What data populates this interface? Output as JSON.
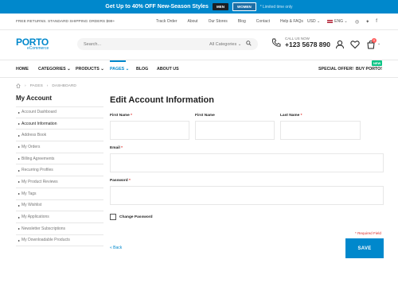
{
  "promo": {
    "text": "Get Up to 40% OFF New-Season Styles",
    "men": "MEN",
    "women": "WOMEN",
    "note": "* Limited time only"
  },
  "topbar": {
    "free_returns": "FREE RETURNS. STANDARD SHIPPING ORDERS $99+",
    "links": [
      "Track Order",
      "About",
      "Our Stores",
      "Blog",
      "Contact",
      "Help & FAQs"
    ],
    "currency": "USD",
    "language": "ENG"
  },
  "header": {
    "logo": "PORTO",
    "logo_sub": "eCommerce",
    "search_placeholder": "Search...",
    "search_category": "All Categories",
    "call_label": "CALL US NOW",
    "call_number": "+123 5678 890",
    "cart_count": "0"
  },
  "nav": {
    "items": [
      "HOME",
      "CATEGORIES",
      "PRODUCTS",
      "PAGES",
      "BLOG",
      "ABOUT US"
    ],
    "special_offer": "SPECIAL OFFER!",
    "buy": "BUY PORTO!",
    "badge": "NEW"
  },
  "breadcrumb": [
    "PAGES",
    "DASHBOARD"
  ],
  "sidebar": {
    "title": "My Account",
    "items": [
      "Account Dashboard",
      "Account Information",
      "Address Book",
      "My Orders",
      "Billing Agreements",
      "Recurring Profiles",
      "My Product Reviews",
      "My Tags",
      "My Wishlist",
      "My Applications",
      "Newsletter Subscriptions",
      "My Downloadable Products"
    ]
  },
  "form": {
    "title": "Edit Account Information",
    "first_name_label": "First Name",
    "middle_name_label": "First Name",
    "last_name_label": "Last Name",
    "email_label": "Email",
    "password_label": "Password",
    "required_mark": "*",
    "change_password": "Change Password",
    "required_note": "* Required Field",
    "back": "« Back",
    "save": "SAVE"
  }
}
